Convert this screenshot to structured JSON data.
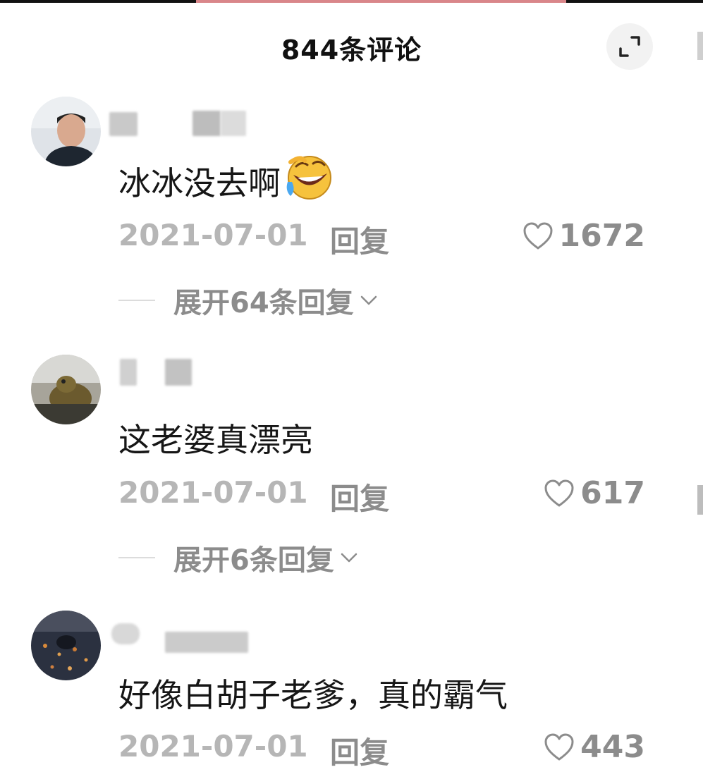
{
  "header": {
    "title": "844条评论"
  },
  "comments": [
    {
      "text": "冰冰没去啊",
      "emoji": "🤣",
      "date": "2021-07-01",
      "reply": "回复",
      "likes": "1672",
      "expand": "展开64条回复"
    },
    {
      "text": "这老婆真漂亮",
      "date": "2021-07-01",
      "reply": "回复",
      "likes": "617",
      "expand": "展开6条回复"
    },
    {
      "text": "好像白胡子老爹，真的霸气",
      "date": "2021-07-01",
      "reply": "回复",
      "likes": "443"
    }
  ],
  "icons": {
    "expand": "fullscreen-exit-icon",
    "like": "heart-outline-icon",
    "chevron": "chevron-down-icon"
  },
  "colors": {
    "meta": "#8c8c8c",
    "date": "#b6b6b6",
    "text": "#161616"
  }
}
